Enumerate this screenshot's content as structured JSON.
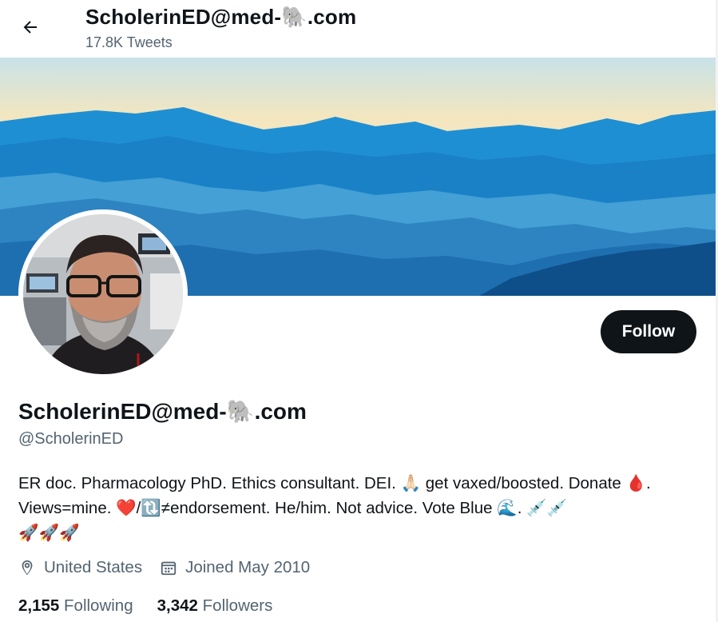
{
  "header": {
    "name_prefix": "ScholerinED@med-",
    "name_emoji": "🐘",
    "name_suffix": ".com",
    "tweet_count": "17.8K Tweets",
    "back_icon": "arrow-left-icon"
  },
  "profile": {
    "follow_label": "Follow",
    "name_prefix": "ScholerinED@med-",
    "name_emoji": "🐘",
    "name_suffix": ".com",
    "handle": "@ScholerinED",
    "bio": {
      "part1": "ER doc. Pharmacology PhD. Ethics consultant. DEI. ",
      "pray_emoji": "🙏🏻",
      "part2": " get vaxed/boosted. Donate ",
      "drop_emoji": "🩸",
      "part3": ". Views=mine. ",
      "heart_emoji": "❤️",
      "slash": "/",
      "retweet_emoji": "🔃",
      "part4": "≠endorsement. He/him. Not advice. Vote Blue ",
      "wave_emoji": "🌊",
      "part5": ". ",
      "syringe_emojis": "💉💉",
      "rocket_emojis": "🚀🚀🚀"
    },
    "location": "United States",
    "joined": "Joined May 2010",
    "following_count": "2,155",
    "following_label": "Following",
    "followers_count": "3,342",
    "followers_label": "Followers"
  },
  "colors": {
    "text_primary": "#0f1419",
    "text_secondary": "#536471",
    "follow_bg": "#0f1419",
    "banner_sky": "#f1e6c4",
    "banner_mountains": "#1f8fd3"
  },
  "icons": {
    "location": "location-pin-icon",
    "calendar": "calendar-icon"
  }
}
